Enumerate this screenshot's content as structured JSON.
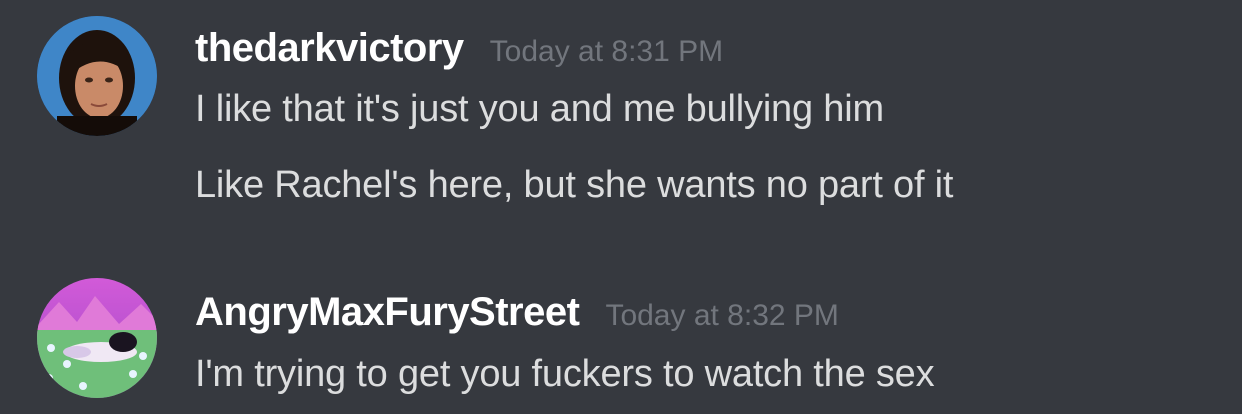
{
  "messages": [
    {
      "author": "thedarkvictory",
      "timestamp": "Today at 8:31 PM",
      "lines": [
        "I like that it's just you and me bullying him",
        "Like Rachel's here, but she wants no part of it"
      ]
    },
    {
      "author": "AngryMaxFuryStreet",
      "timestamp": "Today at 8:32 PM",
      "lines": [
        "I'm trying to get you fuckers to watch the sex"
      ]
    }
  ],
  "colors": {
    "background": "#36393f",
    "username": "#ffffff",
    "timestamp": "#72767d",
    "message_text": "#dcddde"
  }
}
